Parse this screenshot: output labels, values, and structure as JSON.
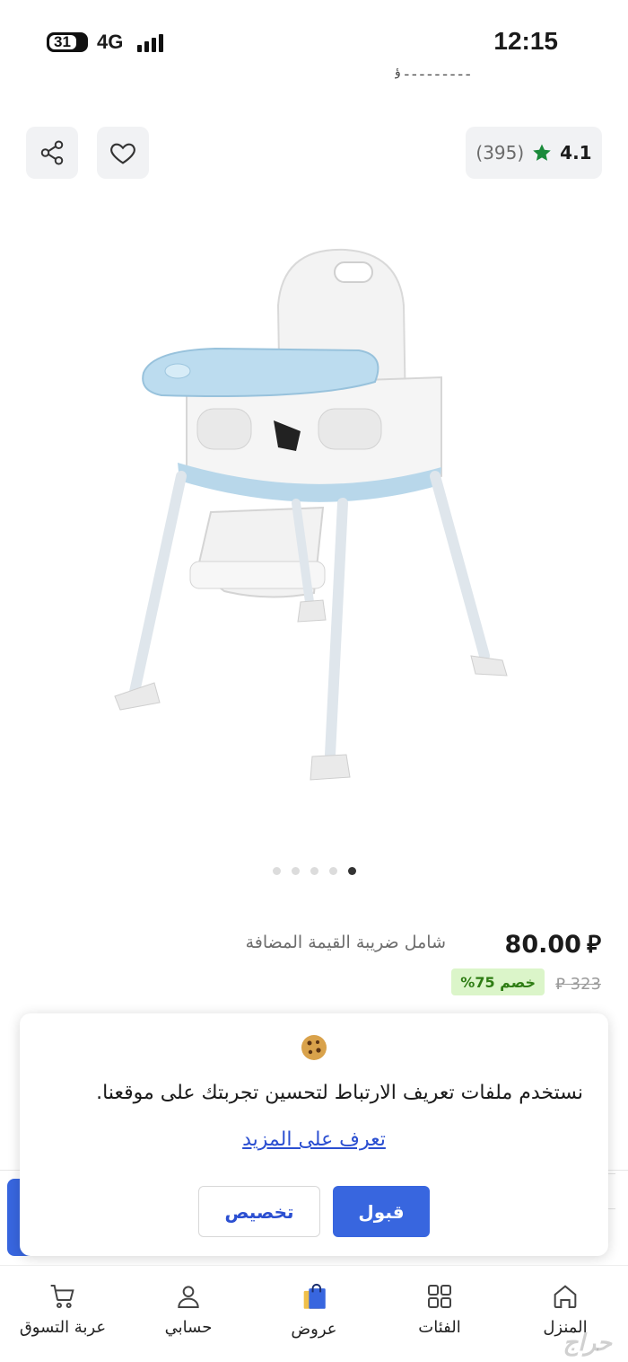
{
  "status_bar": {
    "battery": "31",
    "network": "4G",
    "time": "12:15"
  },
  "header_cut_text": "ـ ـ ـ ـ ـ ـ ـ ـ ـ ؤ",
  "product": {
    "rating": "4.1",
    "reviews": "(395)",
    "price": "80.00",
    "currency_symbol": "⃁",
    "vat_note": "شامل ضريبة القيمة المضافة",
    "old_price": "323",
    "discount": "خصم 75%",
    "image_count": 5,
    "active_image_index": 0
  },
  "cookie_banner": {
    "message": "نستخدم ملفات تعريف الارتباط لتحسين تجربتك على موقعنا.",
    "learn_more": "تعرف على المزيد",
    "accept": "قبول",
    "customize": "تخصيص"
  },
  "bottom_nav": {
    "home": "المنزل",
    "categories": "الفئات",
    "offers": "عروض",
    "account": "حسابي",
    "cart": "عربة التسوق"
  },
  "watermark": "حراج",
  "colors": {
    "accent_blue": "#3866df",
    "discount_bg": "#dbf5c9",
    "discount_text": "#2f7d14",
    "star": "#1a8a3a"
  }
}
